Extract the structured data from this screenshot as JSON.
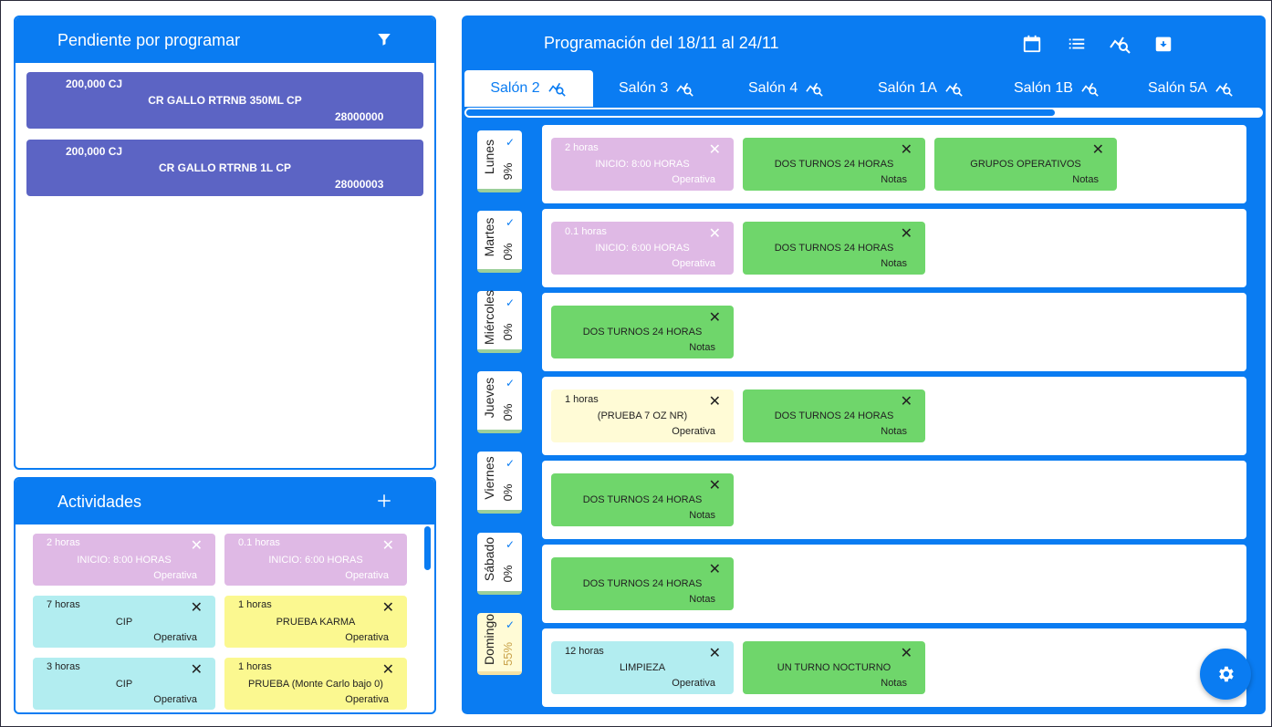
{
  "pending": {
    "title": "Pendiente por programar",
    "items": [
      {
        "qty": "200,000 CJ",
        "name": "CR GALLO RTRNB 350ML CP",
        "code": "28000000"
      },
      {
        "qty": "200,000 CJ",
        "name": "CR GALLO RTRNB 1L CP",
        "code": "28000003"
      }
    ]
  },
  "activities": {
    "title": "Actividades",
    "items": [
      {
        "hours": "2 horas",
        "title": "INICIO: 8:00 HORAS",
        "type": "Operativa"
      },
      {
        "hours": "0.1 horas",
        "title": "INICIO: 6:00 HORAS",
        "type": "Operativa"
      },
      {
        "hours": "7 horas",
        "title": "CIP",
        "type": "Operativa"
      },
      {
        "hours": "1 horas",
        "title": "PRUEBA KARMA",
        "type": "Operativa"
      },
      {
        "hours": "3 horas",
        "title": "CIP",
        "type": "Operativa"
      },
      {
        "hours": "1 horas",
        "title": "PRUEBA (Monte Carlo bajo 0)",
        "type": "Operativa"
      }
    ]
  },
  "schedule": {
    "title": "Programación del 18/11 al 24/11",
    "tabs": [
      "Salón 2",
      "Salón 3",
      "Salón 4",
      "Salón 1A",
      "Salón 1B",
      "Salón 5A"
    ],
    "progress": 0.74,
    "days": [
      {
        "name": "Lunes",
        "pct": "9%",
        "events": [
          {
            "hours": "2 horas",
            "title": "INICIO: 8:00 HORAS",
            "type": "Operativa"
          },
          {
            "hours": "",
            "title": "DOS TURNOS 24 HORAS",
            "type": "Notas"
          },
          {
            "hours": "",
            "title": "GRUPOS OPERATIVOS",
            "type": "Notas"
          }
        ]
      },
      {
        "name": "Martes",
        "pct": "0%",
        "events": [
          {
            "hours": "0.1 horas",
            "title": "INICIO: 6:00 HORAS",
            "type": "Operativa"
          },
          {
            "hours": "",
            "title": "DOS TURNOS 24 HORAS",
            "type": "Notas"
          }
        ]
      },
      {
        "name": "Miércoles",
        "pct": "0%",
        "events": [
          {
            "hours": "",
            "title": "DOS TURNOS 24 HORAS",
            "type": "Notas"
          }
        ]
      },
      {
        "name": "Jueves",
        "pct": "0%",
        "events": [
          {
            "hours": "1 horas",
            "title": "(PRUEBA 7 OZ NR)",
            "type": "Operativa"
          },
          {
            "hours": "",
            "title": "DOS TURNOS 24 HORAS",
            "type": "Notas"
          }
        ]
      },
      {
        "name": "Viernes",
        "pct": "0%",
        "events": [
          {
            "hours": "",
            "title": "DOS TURNOS 24 HORAS",
            "type": "Notas"
          }
        ]
      },
      {
        "name": "Sábado",
        "pct": "0%",
        "events": [
          {
            "hours": "",
            "title": "DOS TURNOS 24 HORAS",
            "type": "Notas"
          }
        ]
      },
      {
        "name": "Domingo",
        "pct": "55%",
        "events": [
          {
            "hours": "12 horas",
            "title": "LIMPIEZA",
            "type": "Operativa"
          },
          {
            "hours": "",
            "title": "UN TURNO NOCTURNO",
            "type": "Notas"
          }
        ]
      }
    ]
  },
  "icons": {
    "filter": "filter-icon",
    "add": "plus-icon",
    "calendar": "calendar-icon",
    "list": "list-icon",
    "analytics": "chart-search-icon",
    "archive": "archive-icon",
    "settings": "gear-icon",
    "close": "close-icon"
  },
  "colors": {
    "primary": "#0a7cf2",
    "pending_card": "#5c64c4",
    "event_purple": "#dfb9e5",
    "event_green": "#6fd66b",
    "event_cyan": "#b2edf0",
    "event_yellow": "#fbf890",
    "event_lightyellow": "#fffbd6"
  }
}
